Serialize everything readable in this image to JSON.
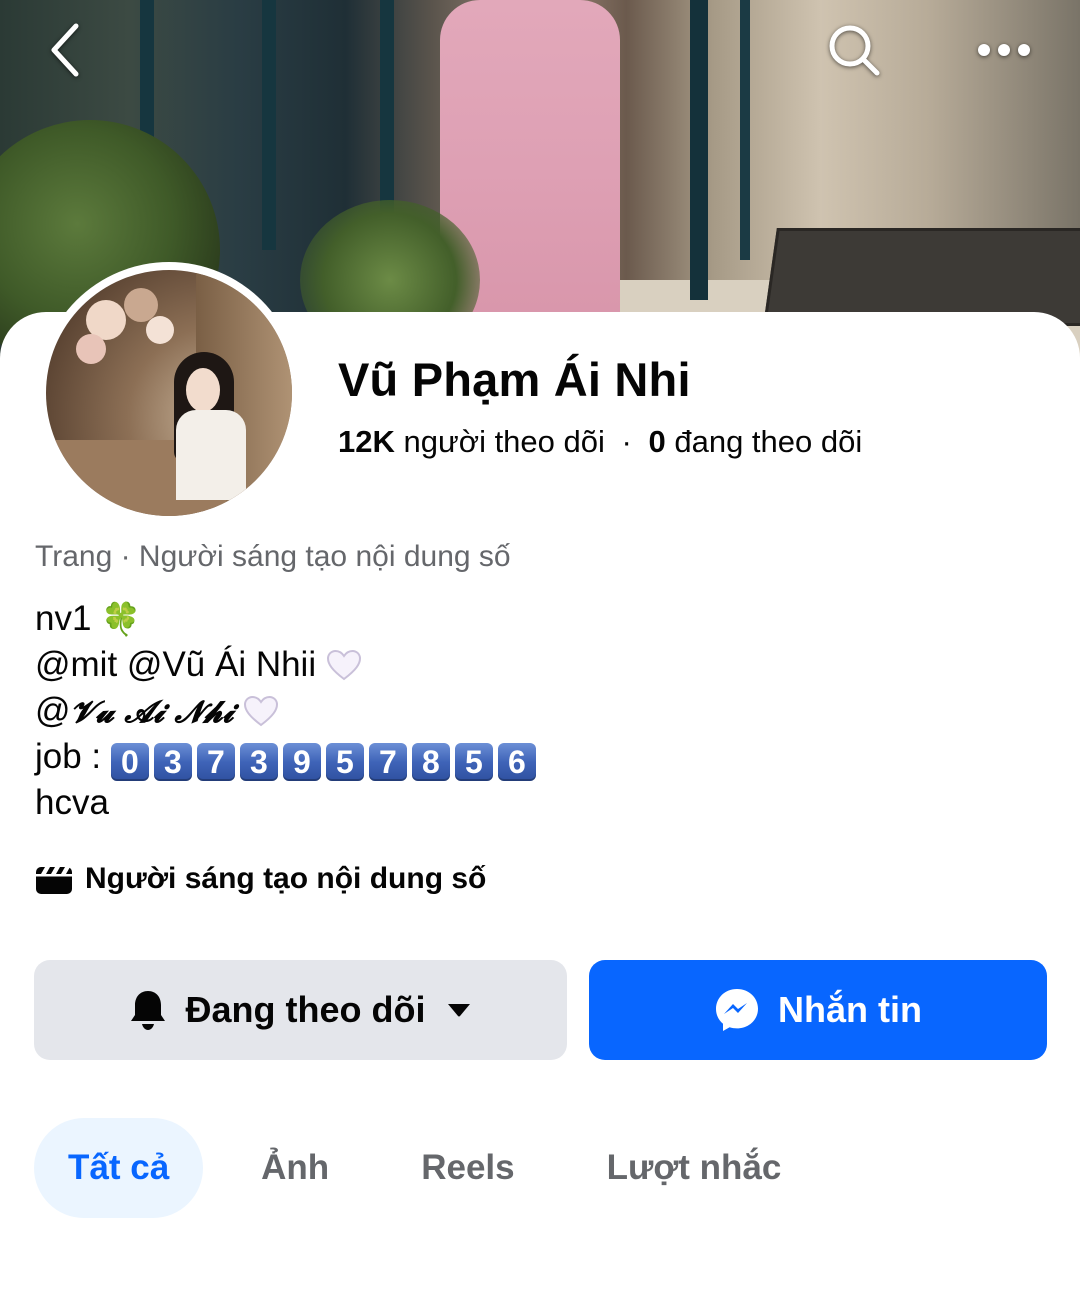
{
  "header": {
    "back_icon": "chevron-left-icon",
    "search_icon": "search-icon",
    "more_icon": "more-horizontal-icon"
  },
  "profile": {
    "name": "Vũ Phạm Ái Nhi",
    "followers_count": "12K",
    "followers_label": "người theo dõi",
    "separator": "·",
    "following_count": "0",
    "following_label": "đang theo dõi",
    "category": "Trang · Người sáng tạo nội dung số"
  },
  "bio": {
    "line1": "nv1",
    "line1_emoji": "🍀",
    "line2": "@mit @Vũ Ái Nhii",
    "line3_prefix": "@",
    "line3_styled": "𝓥𝓾 𝓐𝓲 𝓝𝓱𝓲",
    "line4_prefix": "job :",
    "phone_digits": [
      "0",
      "3",
      "7",
      "3",
      "9",
      "5",
      "7",
      "8",
      "5",
      "6"
    ],
    "line5": "hcva"
  },
  "creator_badge": {
    "icon": "clapperboard-icon",
    "label": "Người sáng tạo nội dung số"
  },
  "actions": {
    "follow_label": "Đang theo dõi",
    "follow_icon": "bell-icon",
    "follow_dropdown_icon": "caret-down-icon",
    "message_label": "Nhắn tin",
    "message_icon": "messenger-icon"
  },
  "tabs": [
    {
      "label": "Tất cả",
      "active": true
    },
    {
      "label": "Ảnh",
      "active": false
    },
    {
      "label": "Reels",
      "active": false
    },
    {
      "label": "Lượt nhắc",
      "active": false
    }
  ],
  "colors": {
    "primary_blue": "#0866ff",
    "secondary_button": "#e4e6eb",
    "active_tab_bg": "#ebf5ff",
    "muted_text": "#65676b"
  }
}
